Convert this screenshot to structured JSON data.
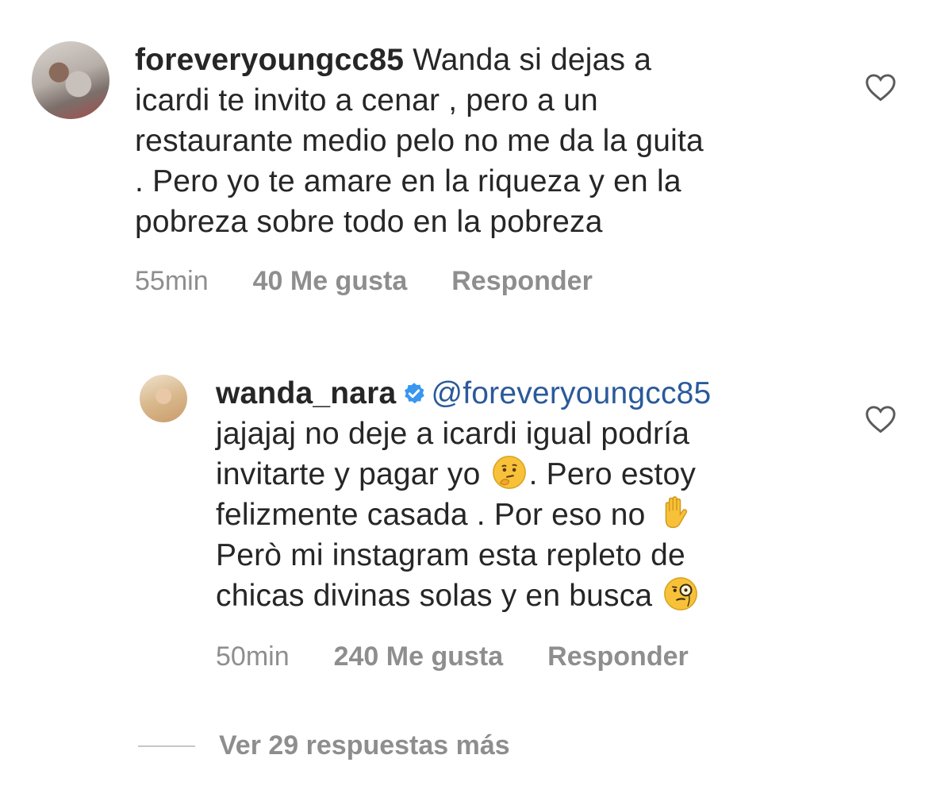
{
  "comments": [
    {
      "username": "foreveryoungcc85",
      "text": "Wanda si dejas a icardi te invito a cenar , pero a un restaurante medio pelo no me da la guita . Pero yo te amare en la riqueza y en la pobreza sobre todo en la pobreza",
      "lines": [
        " Wanda si dejas a",
        "icardi te invito a cenar , pero a un",
        "restaurante medio pelo no me da la guita",
        ". Pero yo te amare en la riqueza y en la",
        "pobreza sobre todo en la pobreza"
      ],
      "time": "55min",
      "likes": "40 Me gusta",
      "reply": "Responder",
      "avatar_icon": "user-avatar"
    },
    {
      "username": "wanda_nara",
      "verified": true,
      "mention": "@foreveryoungcc85",
      "lines": [
        "jajajaj no deje a icardi igual podría",
        "invitarte y pagar yo",
        ". Pero estoy",
        "felizmente casada .  Por eso no",
        "Però mi instagram esta repleto de",
        "chicas divinas solas y en busca"
      ],
      "emojis": [
        "thinking-face",
        "raised-hand",
        "monocle-face"
      ],
      "time": "50min",
      "likes": "240 Me gusta",
      "reply": "Responder",
      "avatar_icon": "user-avatar"
    }
  ],
  "more_replies": "Ver 29 respuestas más",
  "colors": {
    "text": "#262626",
    "meta": "#8e8e8e",
    "mention": "#2a5a9a",
    "verified": "#3897f0"
  }
}
